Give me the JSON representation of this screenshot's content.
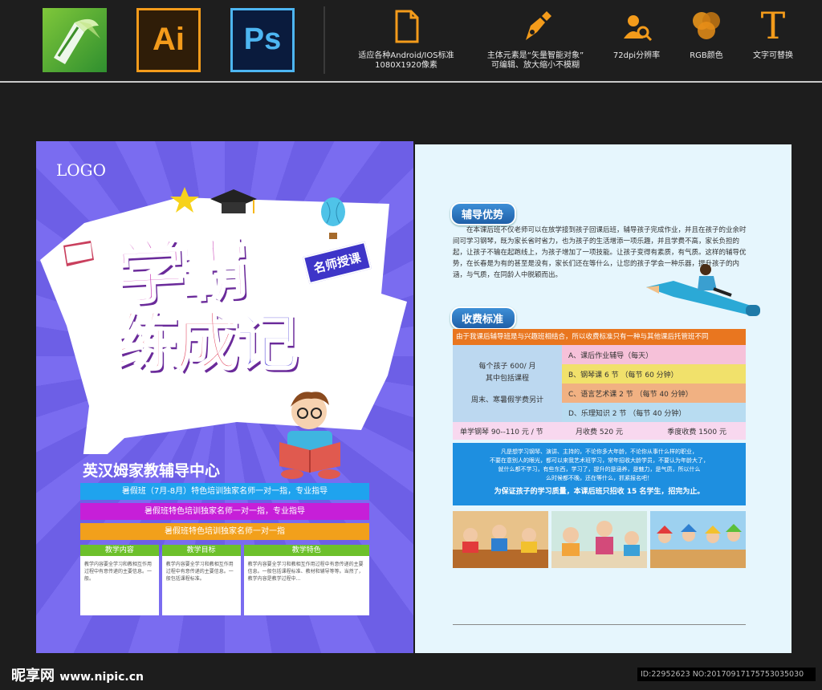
{
  "toolbar": {
    "apps": [
      {
        "name": "CorelDRAW",
        "icon": "corel-icon"
      },
      {
        "name": "Ai",
        "icon": "illustrator-icon"
      },
      {
        "name": "Ps",
        "icon": "photoshop-icon"
      }
    ],
    "features": [
      {
        "icon": "document-icon",
        "line1": "适应各种Android/IOS标准",
        "line2": "1080X1920像素"
      },
      {
        "icon": "pen-nib-icon",
        "line1": "主体元素是“矢量智能对象”",
        "line2": "可编辑、放大缩小不模糊"
      },
      {
        "icon": "user-search-icon",
        "line1": "72dpi分辨率",
        "line2": ""
      },
      {
        "icon": "rgb-circles-icon",
        "line1": "RGB颜色",
        "line2": ""
      },
      {
        "icon": "text-t-icon",
        "line1": "文字可替换",
        "line2": ""
      }
    ]
  },
  "left_page": {
    "logo": "LOGO",
    "title_line1": "学霸",
    "title_line2_a": "练成",
    "title_line2_b": "记",
    "tag": "名师授课",
    "center_name": "英汉姆家教辅导中心",
    "bands": [
      {
        "text": "暑假班（7月-8月）特色培训独家名师一对一指，专业指导",
        "color": "#1fa3ee"
      },
      {
        "text": "暑假班特色培训独家名师一对一指，专业指导",
        "color": "#c61fd8"
      },
      {
        "text": "暑假班特色培训独家名师一对一指",
        "color": "#f2a01b"
      }
    ],
    "columns": [
      {
        "title": "教学内容",
        "body": "教学内容要全学习和教相互作用过程中有意传递的主要信息。一般。"
      },
      {
        "title": "教学目标",
        "body": "教学内容要全学习和教相互作用过程中有意传递的主要信息。一般包括课程标准。"
      },
      {
        "title": "教学特色",
        "body": "教学内容要全学习和教相互作用过程中有意传递的主要信息。一般包括课程标准、教材和辅导等等。当然了，教学内容是教学过程中..."
      }
    ]
  },
  "right_page": {
    "section1": "辅导优势",
    "paragraph": "在本课后班不仅老师可以在放学接到孩子回课后班，辅导孩子完成作业，并且在孩子的业余时间可学习钢琴，既为家长省时省力，也为孩子的生活增添一项乐趣，并且学费不高，家长负担的起，让孩子不输在起跑线上，为孩子增加了一项技能。让孩子变得有素质，有气质。这样的辅导优势，在长春是为有的甚至是没有，家长们还在等什么，让您的孩子学会一种乐器，提升孩子的内涵，与气质，在同龄人中脱颖而出。",
    "section2": "收费标准",
    "fee_header": "由于我课后辅导班是与兴趣班相结合，所以收费标准只有一种与其他课后托管班不同",
    "fee_left": [
      "每个孩子 600/ 月",
      "其中包括课程",
      "",
      "周末、寒暑假学费另计"
    ],
    "fee_rows": [
      {
        "text": "A、课后作业辅导（每天）",
        "color": "#f6c1d9"
      },
      {
        "text": "B、钢琴课 6 节 （每节 60 分钟）",
        "color": "#f1e16b"
      },
      {
        "text": "C、语言艺术课 2 节 （每节 40 分钟）",
        "color": "#f1b182"
      },
      {
        "text": "D、乐理知识 2 节 （每节 40 分钟）",
        "color": "#b8dcf1"
      }
    ],
    "prices": [
      "单学钢琴 90--110 元 / 节",
      "月收费 520 元",
      "季度收费 1500 元"
    ],
    "blue_lines": [
      "凡是想学习钢琴、演讲、主持的，不论你多大年龄，不论你从事什么样的职业，",
      "不要在意别人的眼光，都可以来我艺术班学习，常年招收大龄学员，不要认为年龄大了，",
      "就什么都不学习，有些东西，学习了，提升的是涵养，是魅力，是气质，所以什么",
      "么时候都不晚，还在等什么，抓紧报名吧！"
    ],
    "blue_highlight": "为保证孩子的学习质量，本课后班只招收 15 名学生，招完为止。"
  },
  "watermark": {
    "brand": "昵享网",
    "url": "www.nipic.cn"
  },
  "image_id": "ID:22952623 NO:20170917175753035030"
}
